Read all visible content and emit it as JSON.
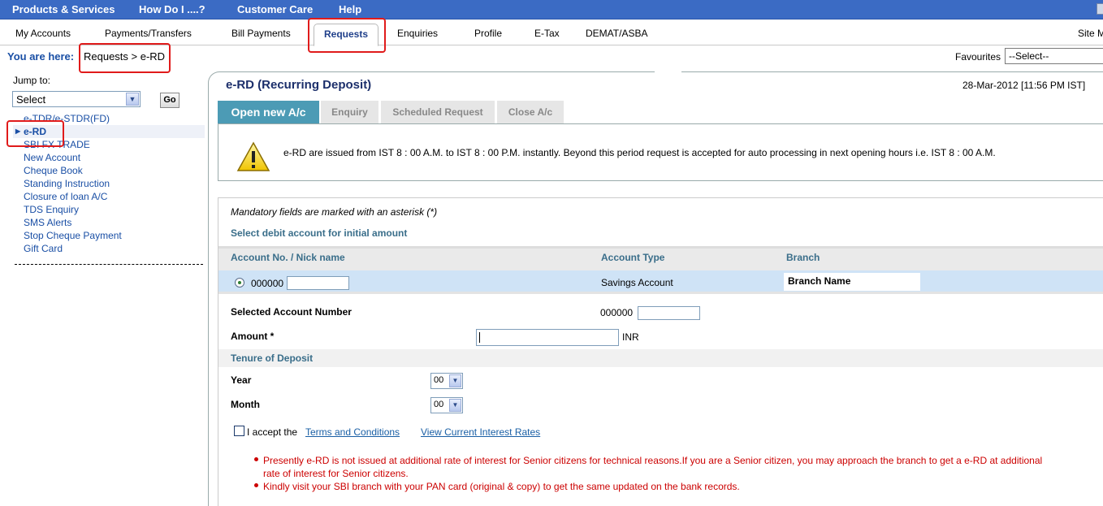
{
  "topnav": {
    "items": [
      "Products & Services",
      "How Do I ....?",
      "Customer Care",
      "Help"
    ]
  },
  "nav2": {
    "items": [
      "My Accounts",
      "Payments/Transfers",
      "Bill Payments",
      "Requests",
      "Enquiries",
      "Profile",
      "E-Tax",
      "DEMAT/ASBA",
      "Site M"
    ],
    "active": "Requests"
  },
  "breadcrumb": {
    "label": "You are here:",
    "path": "Requests > e-RD"
  },
  "favourites": {
    "label": "Favourites",
    "selected": "--Select--"
  },
  "sidebar": {
    "jump_label": "Jump to:",
    "jump_selected": "Select",
    "go_label": "Go",
    "items": [
      "e-TDR/e-STDR(FD)",
      "e-RD",
      "SBI FX TRADE",
      "New Account",
      "Cheque Book",
      "Standing Instruction",
      "Closure of loan A/C",
      "TDS Enquiry",
      "SMS Alerts",
      "Stop Cheque Payment",
      "Gift Card"
    ],
    "active": "e-RD"
  },
  "main": {
    "title": "e-RD (Recurring Deposit)",
    "timestamp": "28-Mar-2012 [11:56 PM IST]",
    "tabs": [
      "Open new A/c",
      "Enquiry",
      "Scheduled Request",
      "Close A/c"
    ],
    "notice": "e-RD are issued from IST 8 : 00 A.M. to IST 8 : 00 P.M. instantly. Beyond this period request is accepted for auto processing in next opening hours i.e. IST 8 : 00 A.M."
  },
  "form": {
    "mandatory_note": "Mandatory fields are marked with an asterisk (*)",
    "debit_heading": "Select debit account for initial amount",
    "columns": [
      "Account No. / Nick name",
      "Account Type",
      "Branch"
    ],
    "account": {
      "number": "000000",
      "type": "Savings Account",
      "branch": "Branch Name"
    },
    "selected_account_label": "Selected Account Number",
    "selected_account_value": "000000",
    "amount_label": "Amount *",
    "amount_unit": "INR",
    "tenure_heading": "Tenure of Deposit",
    "year_label": "Year",
    "year_value": "00",
    "month_label": "Month",
    "month_value": "00",
    "accept_text": "I accept the",
    "terms_link": "Terms and Conditions",
    "rates_link": "View Current Interest Rates"
  },
  "notes": [
    "Presently e-RD is not issued at additional rate of interest for Senior citizens for technical reasons.If you are a Senior citizen, you may approach the branch to get a e-RD at additional",
    "rate of interest for Senior citizens.",
    "Kindly visit your SBI branch with your PAN card (original & copy) to get the same updated on the bank records."
  ],
  "colors": {
    "topbar": "#3b6bc4",
    "accent_tab": "#4c9bb5",
    "link": "#1a4fa5",
    "alert": "#c00000",
    "highlight": "#e01b1b"
  }
}
